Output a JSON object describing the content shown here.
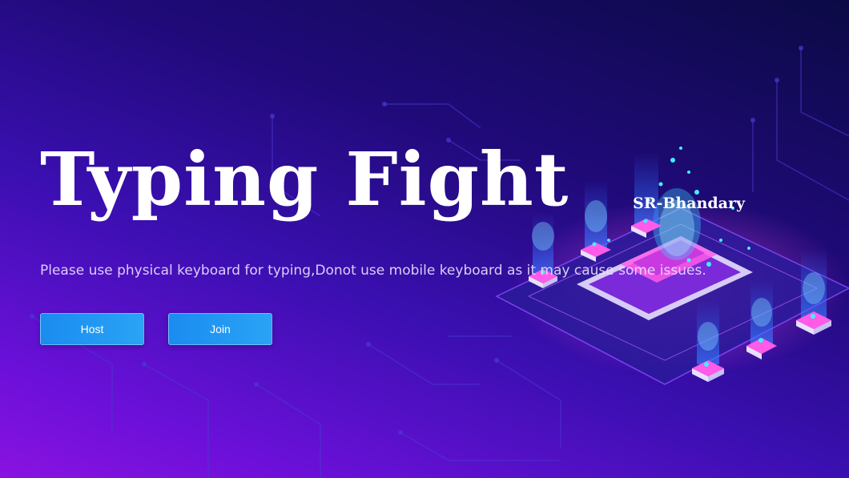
{
  "header": {
    "title": "Typing Fight",
    "author": "SR-Bhandary"
  },
  "main": {
    "notice": "Please use physical keyboard for typing,Donot use mobile keyboard as it may cause some issues.",
    "buttons": {
      "host_label": "Host",
      "join_label": "Join"
    }
  },
  "colors": {
    "button": "#1a8cf0",
    "text": "#ffffff",
    "accent_glow": "#ff3fd8",
    "accent_cyan": "#3ff0ff"
  }
}
